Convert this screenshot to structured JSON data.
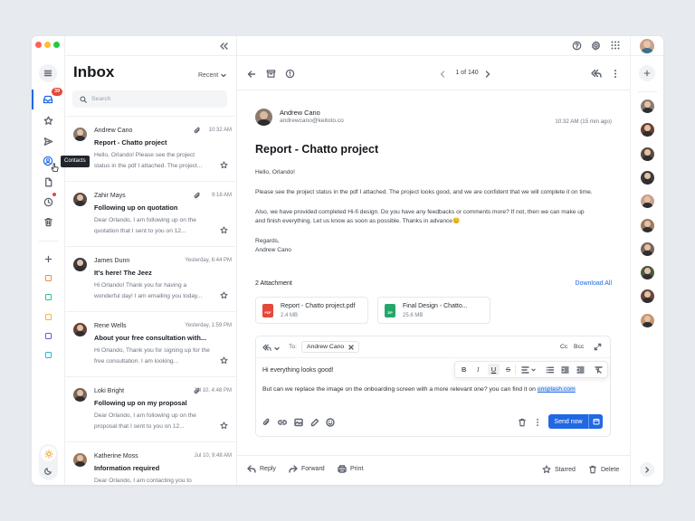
{
  "colors": {
    "accent": "#2168e2",
    "badge": "#e5483b",
    "traffic_red": "#ff5f57",
    "traffic_yellow": "#febc2e",
    "traffic_green": "#28c840"
  },
  "rail": {
    "badge_count": "39",
    "tooltip": "Contacts",
    "nav_icons": [
      "menu-icon",
      "inbox-icon",
      "star-icon",
      "send-icon",
      "contacts-icon",
      "document-icon",
      "clock-icon",
      "trash-icon"
    ],
    "label_colors": [
      "#f08a3c",
      "#2fbf8f",
      "#f2b53b",
      "#7c4de0",
      "#2bb8c9"
    ]
  },
  "list": {
    "title": "Inbox",
    "sort_label": "Recent",
    "search_placeholder": "Search",
    "items": [
      {
        "name": "Andrew Cano",
        "time": "10:32 AM",
        "subject": "Report - Chatto project",
        "preview": "Hello, Orlando! Please see the project status in the pdf I attached. The project...",
        "attachment": true,
        "avatar": "#8a7a6c"
      },
      {
        "name": "Zahir Mays",
        "time": "9:18 AM",
        "subject": "Following up on quotation",
        "preview": "Dear Orlando, I am following up on the quotation that I sent to you on 12...",
        "attachment": true,
        "avatar": "#5b4a3f"
      },
      {
        "name": "James Dunn",
        "time": "Yesterday, 6:44 PM",
        "subject": "It's here! The Jeez",
        "preview": "Hi Orlando! Thank you for having a wonderful day! I am emailing you today...",
        "attachment": false,
        "avatar": "#3c3a3a"
      },
      {
        "name": "Rene Wells",
        "time": "Yesterday, 1:59 PM",
        "subject": "About your free consultation with...",
        "preview": "Hi Orlando, Thank you for signing up for the free consultation. I am looking...",
        "attachment": false,
        "avatar": "#6a3f35"
      },
      {
        "name": "Loki Bright",
        "time": "Jul 10, 4:48 PM",
        "subject": "Following up on my proposal",
        "preview": "Dear Orlando, I am following up on the proposal that I sent to you on 12...",
        "attachment": true,
        "avatar": "#7a6458"
      },
      {
        "name": "Katherine Moss",
        "time": "Jul 10, 9:48 AM",
        "subject": "Information required",
        "preview": "Dear Orlando, I am contacting you to",
        "attachment": false,
        "avatar": "#a0785e"
      }
    ]
  },
  "reader": {
    "pagination": "1 of 140",
    "sender_name": "Andrew Cano",
    "sender_email": "andrewcano@keitoto.co",
    "received": "10:32 AM (15 min ago)",
    "subject": "Report - Chatto project",
    "body": [
      "Hello, Orlando!",
      "Please see the project status in the pdf I attached. The project looks good, and we are confident that we will complete it on time.",
      "Also, we have provided completed Hi-fi design. Do you have any feedbacks or comments more? If not, then we can make up",
      "and finish everything. Let us know as soon as possible. Thanks in advance😊",
      "Regards,",
      "Andrew Cano"
    ],
    "attachments_label": "2 Attachment",
    "download_all": "Download All",
    "attachments": [
      {
        "name": "Report - Chatto project.pdf",
        "size": "2.4 MB",
        "type": "PDF",
        "color": "#e5483b"
      },
      {
        "name": "Final Design - Chatto...",
        "size": "25.6 MB",
        "type": "ZIP",
        "color": "#24a86a"
      }
    ],
    "compose": {
      "to_label": "To:",
      "recipient": "Andrew Cano",
      "cc": "Cc",
      "bcc": "Bcc",
      "line1": "Hi everything looks good!",
      "line2_text": "But can we replace the image on the onboarding screen with a more relevant one? you can find it on",
      "line2_link": "unsplash.com",
      "send": "Send now"
    },
    "footer": {
      "reply": "Reply",
      "forward": "Forward",
      "print": "Print",
      "starred": "Starred",
      "delete": "Delete"
    }
  },
  "right_rail": {
    "avatar_colors": [
      "#8a7a6c",
      "#6a3f35",
      "#5b4a3f",
      "#3c3a3a",
      "#c9a08a",
      "#a0785e",
      "#7a6458",
      "#4a5a3f",
      "#6a4438",
      "#c8956e"
    ]
  }
}
